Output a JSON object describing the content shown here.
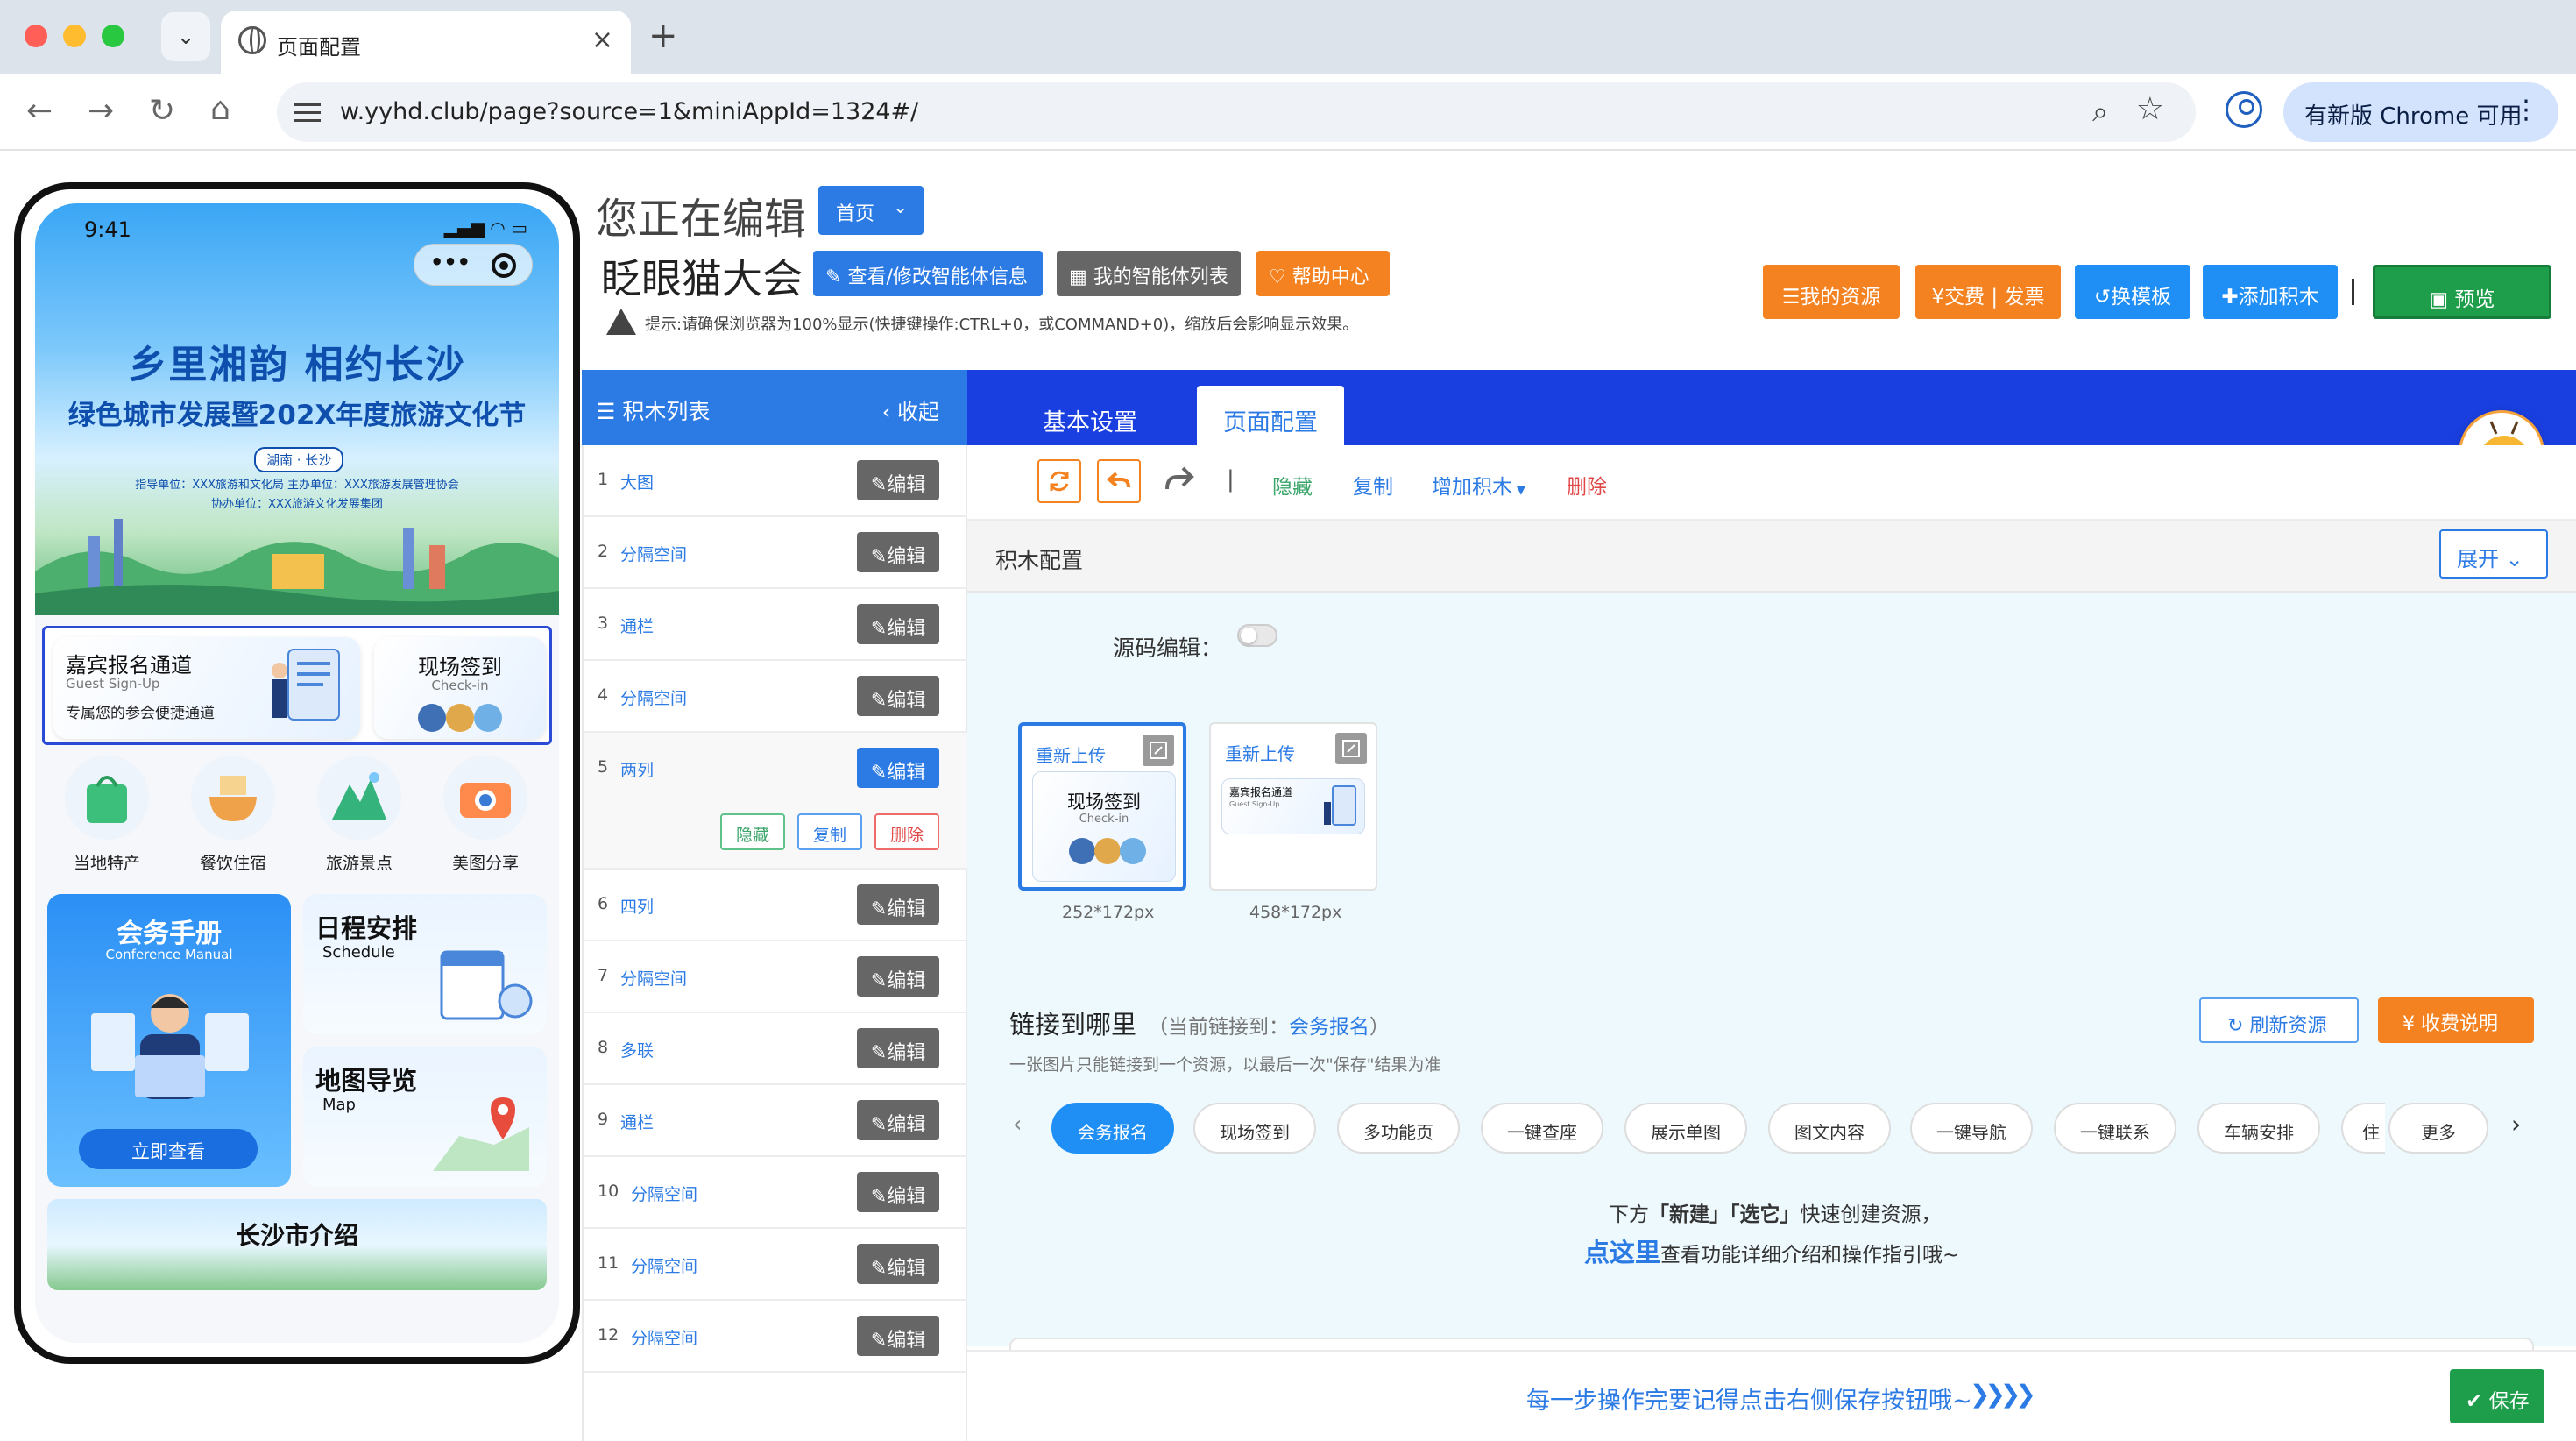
{
  "browser": {
    "tab_title": "页面配置",
    "url": "w.yyhd.club/page?source=1&miniAppId=1324#/",
    "update_label": "有新版 Chrome 可用"
  },
  "phone": {
    "time": "9:41",
    "hero": {
      "title1": "乡里湘韵 相约长沙",
      "title2": "绿色城市发展暨202X年度旅游文化节",
      "tag": "湖南 · 长沙",
      "org1": "指导单位：XXX旅游和文化局 主办单位：XXX旅游发展管理协会",
      "org2": "协办单位：XXX旅游文化发展集团"
    },
    "signup": {
      "title": "嘉宾报名通道",
      "subtitle": "Guest Sign-Up",
      "desc": "专属您的参会便捷通道"
    },
    "checkin": {
      "title": "现场签到",
      "subtitle": "Check-in"
    },
    "quick": [
      "当地特产",
      "餐饮住宿",
      "旅游景点",
      "美图分享"
    ],
    "manual": {
      "title": "会务手册",
      "subtitle": "Conference Manual",
      "button": "立即查看"
    },
    "schedule": {
      "title": "日程安排",
      "subtitle": "Schedule"
    },
    "map": {
      "title": "地图导览",
      "subtitle": "Map"
    },
    "intro": "长沙市介绍"
  },
  "header": {
    "editing_label": "您正在编辑",
    "page_select": "首页",
    "agent_name": "眨眼猫大会",
    "btn_view_info": "查看/修改智能体信息",
    "btn_my_agents": "我的智能体列表",
    "btn_help": "帮助中心",
    "tip": "提示:请确保浏览器为100%显示(快捷键操作:CTRL+0，或COMMAND+0)，缩放后会影响显示效果。",
    "btn_my_resources": "我的资源",
    "btn_billing": "¥交费 | 发票",
    "btn_template": "换模板",
    "btn_add_block": "添加积木",
    "btn_preview": "预览"
  },
  "blocklist": {
    "title": "积木列表",
    "collapse": "收起",
    "edit_label": "编辑",
    "items": [
      {
        "num": "1",
        "name": "大图"
      },
      {
        "num": "2",
        "name": "分隔空间"
      },
      {
        "num": "3",
        "name": "通栏"
      },
      {
        "num": "4",
        "name": "分隔空间"
      },
      {
        "num": "5",
        "name": "两列"
      },
      {
        "num": "6",
        "name": "四列"
      },
      {
        "num": "7",
        "name": "分隔空间"
      },
      {
        "num": "8",
        "name": "多联"
      },
      {
        "num": "9",
        "name": "通栏"
      },
      {
        "num": "10",
        "name": "分隔空间"
      },
      {
        "num": "11",
        "name": "分隔空间"
      },
      {
        "num": "12",
        "name": "分隔空间"
      }
    ],
    "active_actions": {
      "hide": "隐藏",
      "copy": "复制",
      "delete": "删除"
    }
  },
  "panel": {
    "tabs": [
      "基本设置",
      "页面配置"
    ],
    "actions": {
      "hide": "隐藏",
      "copy": "复制",
      "add": "增加积木",
      "delete": "删除"
    },
    "config_title": "积木配置",
    "expand": "展开",
    "source_edit": "源码编辑：",
    "reupload": "重新上传",
    "thumbs": [
      {
        "title": "现场签到",
        "sub": "Check-in",
        "size": "252*172px"
      },
      {
        "title": "嘉宾报名通道",
        "sub": "Guest Sign-Up",
        "size": "458*172px"
      }
    ],
    "link": {
      "title": "链接到哪里",
      "current_prefix": "（当前链接到：",
      "current_value": "会务报名",
      "current_suffix": "）",
      "hint": "一张图片只能链接到一个资源，以最后一次\"保存\"结果为准",
      "refresh": "刷新资源",
      "fee": "收费说明",
      "resources": [
        "会务报名",
        "现场签到",
        "多功能页",
        "一键查座",
        "展示单图",
        "图文内容",
        "一键导航",
        "一键联系",
        "车辆安排",
        "住",
        "更多"
      ]
    },
    "create_hint_pre": "下方",
    "create_hint_bold": "「新建」「选它」",
    "create_hint_post": "快速创建资源，",
    "guide_link": "点这里",
    "guide_post": "查看功能详细介绍和操作指引哦~",
    "footer_tip": "每一步操作完要记得点击右侧保存按钮哦~",
    "save": "保存"
  }
}
